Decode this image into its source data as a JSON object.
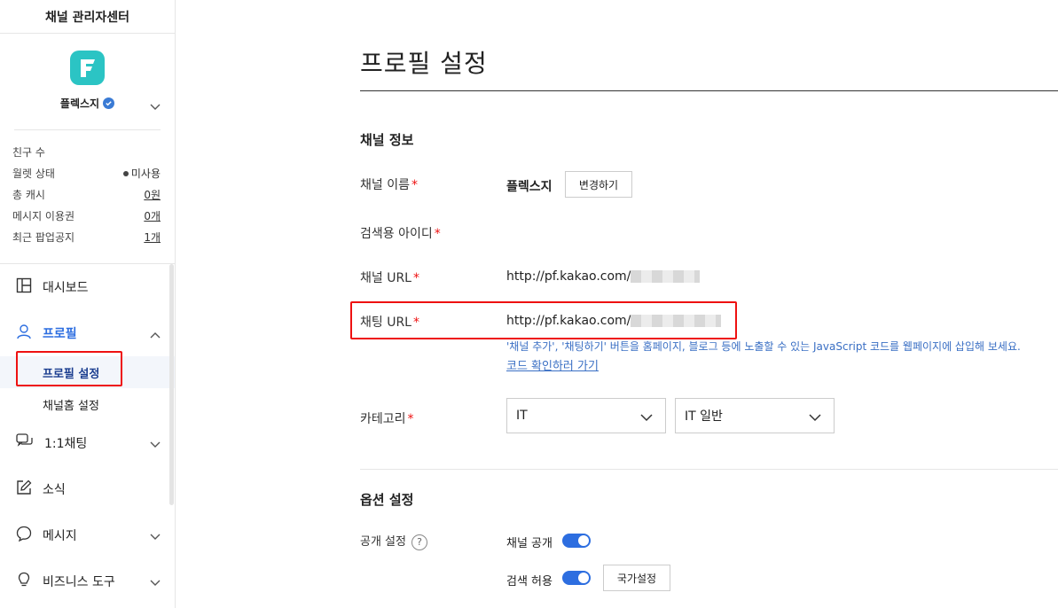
{
  "sidebar": {
    "app_title": "채널 관리자센터",
    "channel_name": "플렉스지",
    "stats": [
      {
        "label": "친구 수",
        "value": ""
      },
      {
        "label": "월렛 상태",
        "value": "미사용"
      },
      {
        "label": "총 캐시",
        "value": "0원"
      },
      {
        "label": "메시지 이용권",
        "value": "0개"
      },
      {
        "label": "최근 팝업공지",
        "value": "1개"
      }
    ],
    "nav": {
      "dashboard": "대시보드",
      "profile": "프로필",
      "profile_settings": "프로필 설정",
      "channel_home_settings": "채널홈 설정",
      "chat": "1:1채팅",
      "news": "소식",
      "message": "메시지",
      "business_tools": "비즈니스 도구"
    }
  },
  "main": {
    "page_title": "프로필 설정",
    "channel_info": {
      "section_title": "채널 정보",
      "name_label": "채널 이름",
      "name_value": "플렉스지",
      "change_button": "변경하기",
      "search_id_label": "검색용 아이디",
      "channel_url_label": "채널 URL",
      "channel_url_value": "http://pf.kakao.com/",
      "chat_url_label": "채팅 URL",
      "chat_url_value": "http://pf.kakao.com/",
      "chat_url_help": "'채널 추가', '채팅하기' 버튼을 홈페이지, 블로그 등에 노출할 수 있는 JavaScript 코드를 웹페이지에 삽입해 보세요.",
      "code_link": "코드 확인하러 가기",
      "category_label": "카테고리",
      "category_main": "IT",
      "category_sub": "IT 일반",
      "required_mark": "*"
    },
    "options": {
      "section_title": "옵션 설정",
      "visibility_label": "공개 설정",
      "help_mark": "?",
      "channel_public": "채널 공개",
      "search_allowed": "검색 허용",
      "country_button": "국가설정"
    }
  },
  "colors": {
    "accent": "#2d6ee0",
    "logo": "#2bc4c4",
    "highlight_box": "#ee1111",
    "required": "#ee1111"
  }
}
